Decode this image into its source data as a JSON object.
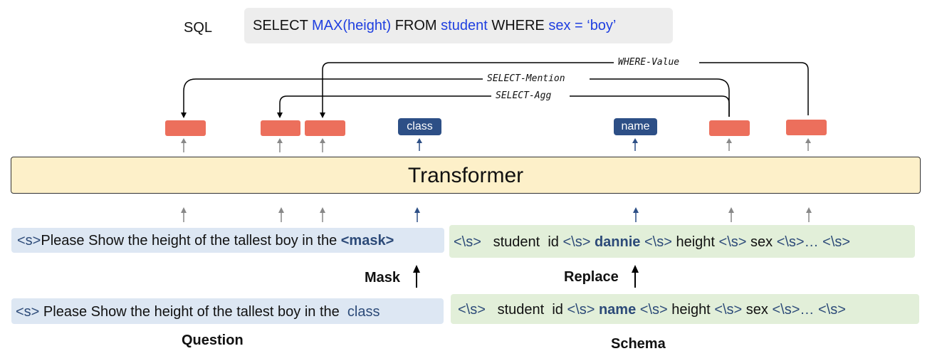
{
  "sql": {
    "label": "SQL",
    "parts": [
      "SELECT ",
      "MAX(height)",
      " FROM ",
      "student",
      " WHERE ",
      "sex = ‘boy’"
    ]
  },
  "links": {
    "where_value": "WHERE-Value",
    "select_mention": "SELECT-Mention",
    "select_agg": "SELECT-Agg"
  },
  "tags": {
    "class": "class",
    "name": "name"
  },
  "transformer": "Transformer",
  "masked_question": {
    "start": "<s>",
    "text": "Please Show the height of the tallest boy in the ",
    "mask": "<mask>"
  },
  "replaced_schema": {
    "sep": "<\\s>",
    "student": "student",
    "id": "id",
    "dannie": "dannie",
    "height": "height",
    "sex": "sex",
    "ellipsis": "<\\s>…",
    "end": "<\\s>"
  },
  "steps": {
    "mask": "Mask",
    "replace": "Replace"
  },
  "question": {
    "start": "<s>",
    "text": "Please Show the height of the tallest boy in the ",
    "word": "class"
  },
  "schema": {
    "sep": "<\\s>",
    "student": "student",
    "id": "id",
    "name": "name",
    "height": "height",
    "sex": "sex",
    "ellipsis": "<\\s>…",
    "end": "<\\s>"
  },
  "captions": {
    "question": "Question",
    "schema": "Schema"
  },
  "colors": {
    "accent_red": "#ec6f5c",
    "tag_blue": "#2d4f86",
    "question_bg": "#dde7f3",
    "schema_bg": "#e2efd9",
    "transformer_bg": "#fdf0c9"
  }
}
